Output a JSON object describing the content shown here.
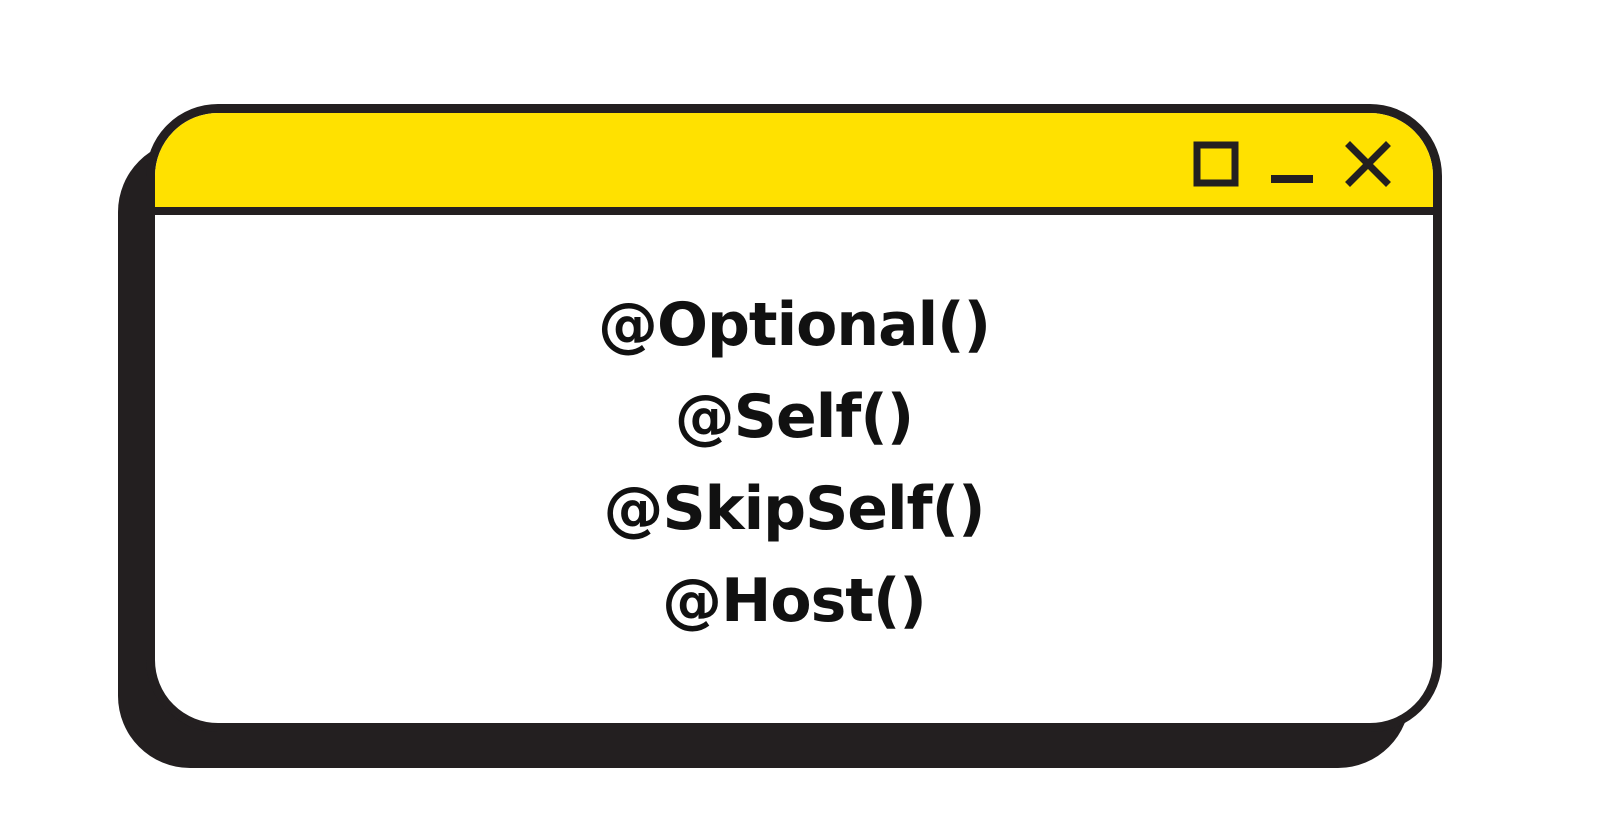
{
  "window": {
    "controls": {
      "maximize_icon": "maximize-square-icon",
      "minimize_icon": "minimize-bar-icon",
      "close_icon": "close-x-icon"
    },
    "colors": {
      "titlebar": "#ffe100",
      "outline": "#231f20",
      "body": "#ffffff",
      "text": "#111111"
    }
  },
  "content": {
    "items": [
      {
        "label": "@Optional()"
      },
      {
        "label": "@Self()"
      },
      {
        "label": "@SkipSelf()"
      },
      {
        "label": "@Host()"
      }
    ]
  }
}
